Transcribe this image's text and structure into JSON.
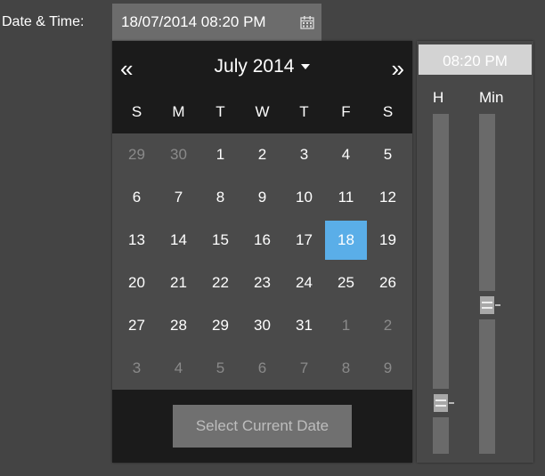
{
  "form": {
    "label": "Date & Time:",
    "value": "18/07/2014 08:20 PM",
    "icon": "calendar-icon"
  },
  "calendar": {
    "prev_icon": "«",
    "next_icon": "»",
    "month_title": "July 2014",
    "weekdays": [
      "S",
      "M",
      "T",
      "W",
      "T",
      "F",
      "S"
    ],
    "weeks": [
      [
        {
          "d": "29",
          "m": true
        },
        {
          "d": "30",
          "m": true
        },
        {
          "d": "1"
        },
        {
          "d": "2"
        },
        {
          "d": "3"
        },
        {
          "d": "4"
        },
        {
          "d": "5"
        }
      ],
      [
        {
          "d": "6"
        },
        {
          "d": "7"
        },
        {
          "d": "8"
        },
        {
          "d": "9"
        },
        {
          "d": "10"
        },
        {
          "d": "11"
        },
        {
          "d": "12"
        }
      ],
      [
        {
          "d": "13"
        },
        {
          "d": "14"
        },
        {
          "d": "15"
        },
        {
          "d": "16"
        },
        {
          "d": "17"
        },
        {
          "d": "18",
          "sel": true
        },
        {
          "d": "19"
        }
      ],
      [
        {
          "d": "20"
        },
        {
          "d": "21"
        },
        {
          "d": "22"
        },
        {
          "d": "23"
        },
        {
          "d": "24"
        },
        {
          "d": "25"
        },
        {
          "d": "26"
        }
      ],
      [
        {
          "d": "27"
        },
        {
          "d": "28"
        },
        {
          "d": "29"
        },
        {
          "d": "30"
        },
        {
          "d": "31"
        },
        {
          "d": "1",
          "m": true
        },
        {
          "d": "2",
          "m": true
        }
      ],
      [
        {
          "d": "3",
          "m": true
        },
        {
          "d": "4",
          "m": true
        },
        {
          "d": "5",
          "m": true
        },
        {
          "d": "6",
          "m": true
        },
        {
          "d": "7",
          "m": true
        },
        {
          "d": "8",
          "m": true
        },
        {
          "d": "9",
          "m": true
        }
      ]
    ],
    "select_current_label": "Select Current Date",
    "selected_color": "#5aaee8"
  },
  "time": {
    "display": "08:20 PM",
    "hour_label": "H",
    "minute_label": "Min",
    "hour_value": 20,
    "hour_max": 23,
    "minute_value": 20,
    "minute_max": 59
  }
}
